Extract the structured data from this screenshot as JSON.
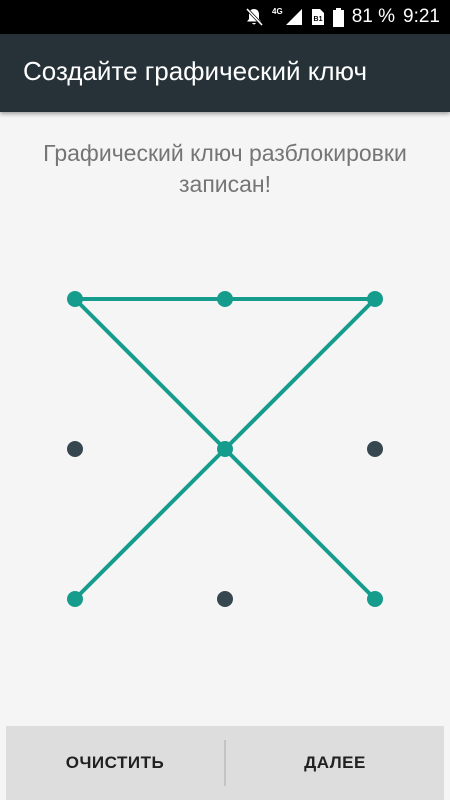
{
  "status_bar": {
    "network": "4G",
    "sim": "B1",
    "battery": "81 %",
    "time": "9:21"
  },
  "toolbar": {
    "title": "Создайте графический ключ"
  },
  "message": {
    "line1": "Графический ключ разблокировки",
    "line2": "записан!"
  },
  "pattern": {
    "grid": [
      {
        "id": 1,
        "row": 0,
        "col": 0,
        "selected": true
      },
      {
        "id": 2,
        "row": 0,
        "col": 1,
        "selected": true
      },
      {
        "id": 3,
        "row": 0,
        "col": 2,
        "selected": true
      },
      {
        "id": 4,
        "row": 1,
        "col": 0,
        "selected": false
      },
      {
        "id": 5,
        "row": 1,
        "col": 1,
        "selected": true
      },
      {
        "id": 6,
        "row": 1,
        "col": 2,
        "selected": false
      },
      {
        "id": 7,
        "row": 2,
        "col": 0,
        "selected": true
      },
      {
        "id": 8,
        "row": 2,
        "col": 1,
        "selected": false
      },
      {
        "id": 9,
        "row": 2,
        "col": 2,
        "selected": true
      }
    ],
    "sequence": [
      1,
      2,
      3,
      5,
      7
    ],
    "sequence_extra": [
      1,
      5,
      9
    ]
  },
  "colors": {
    "accent": "#169c8c",
    "dot_inactive": "#37474f",
    "toolbar": "#263238"
  },
  "buttons": {
    "clear": "ОЧИСТИТЬ",
    "next": "ДАЛЕЕ"
  }
}
